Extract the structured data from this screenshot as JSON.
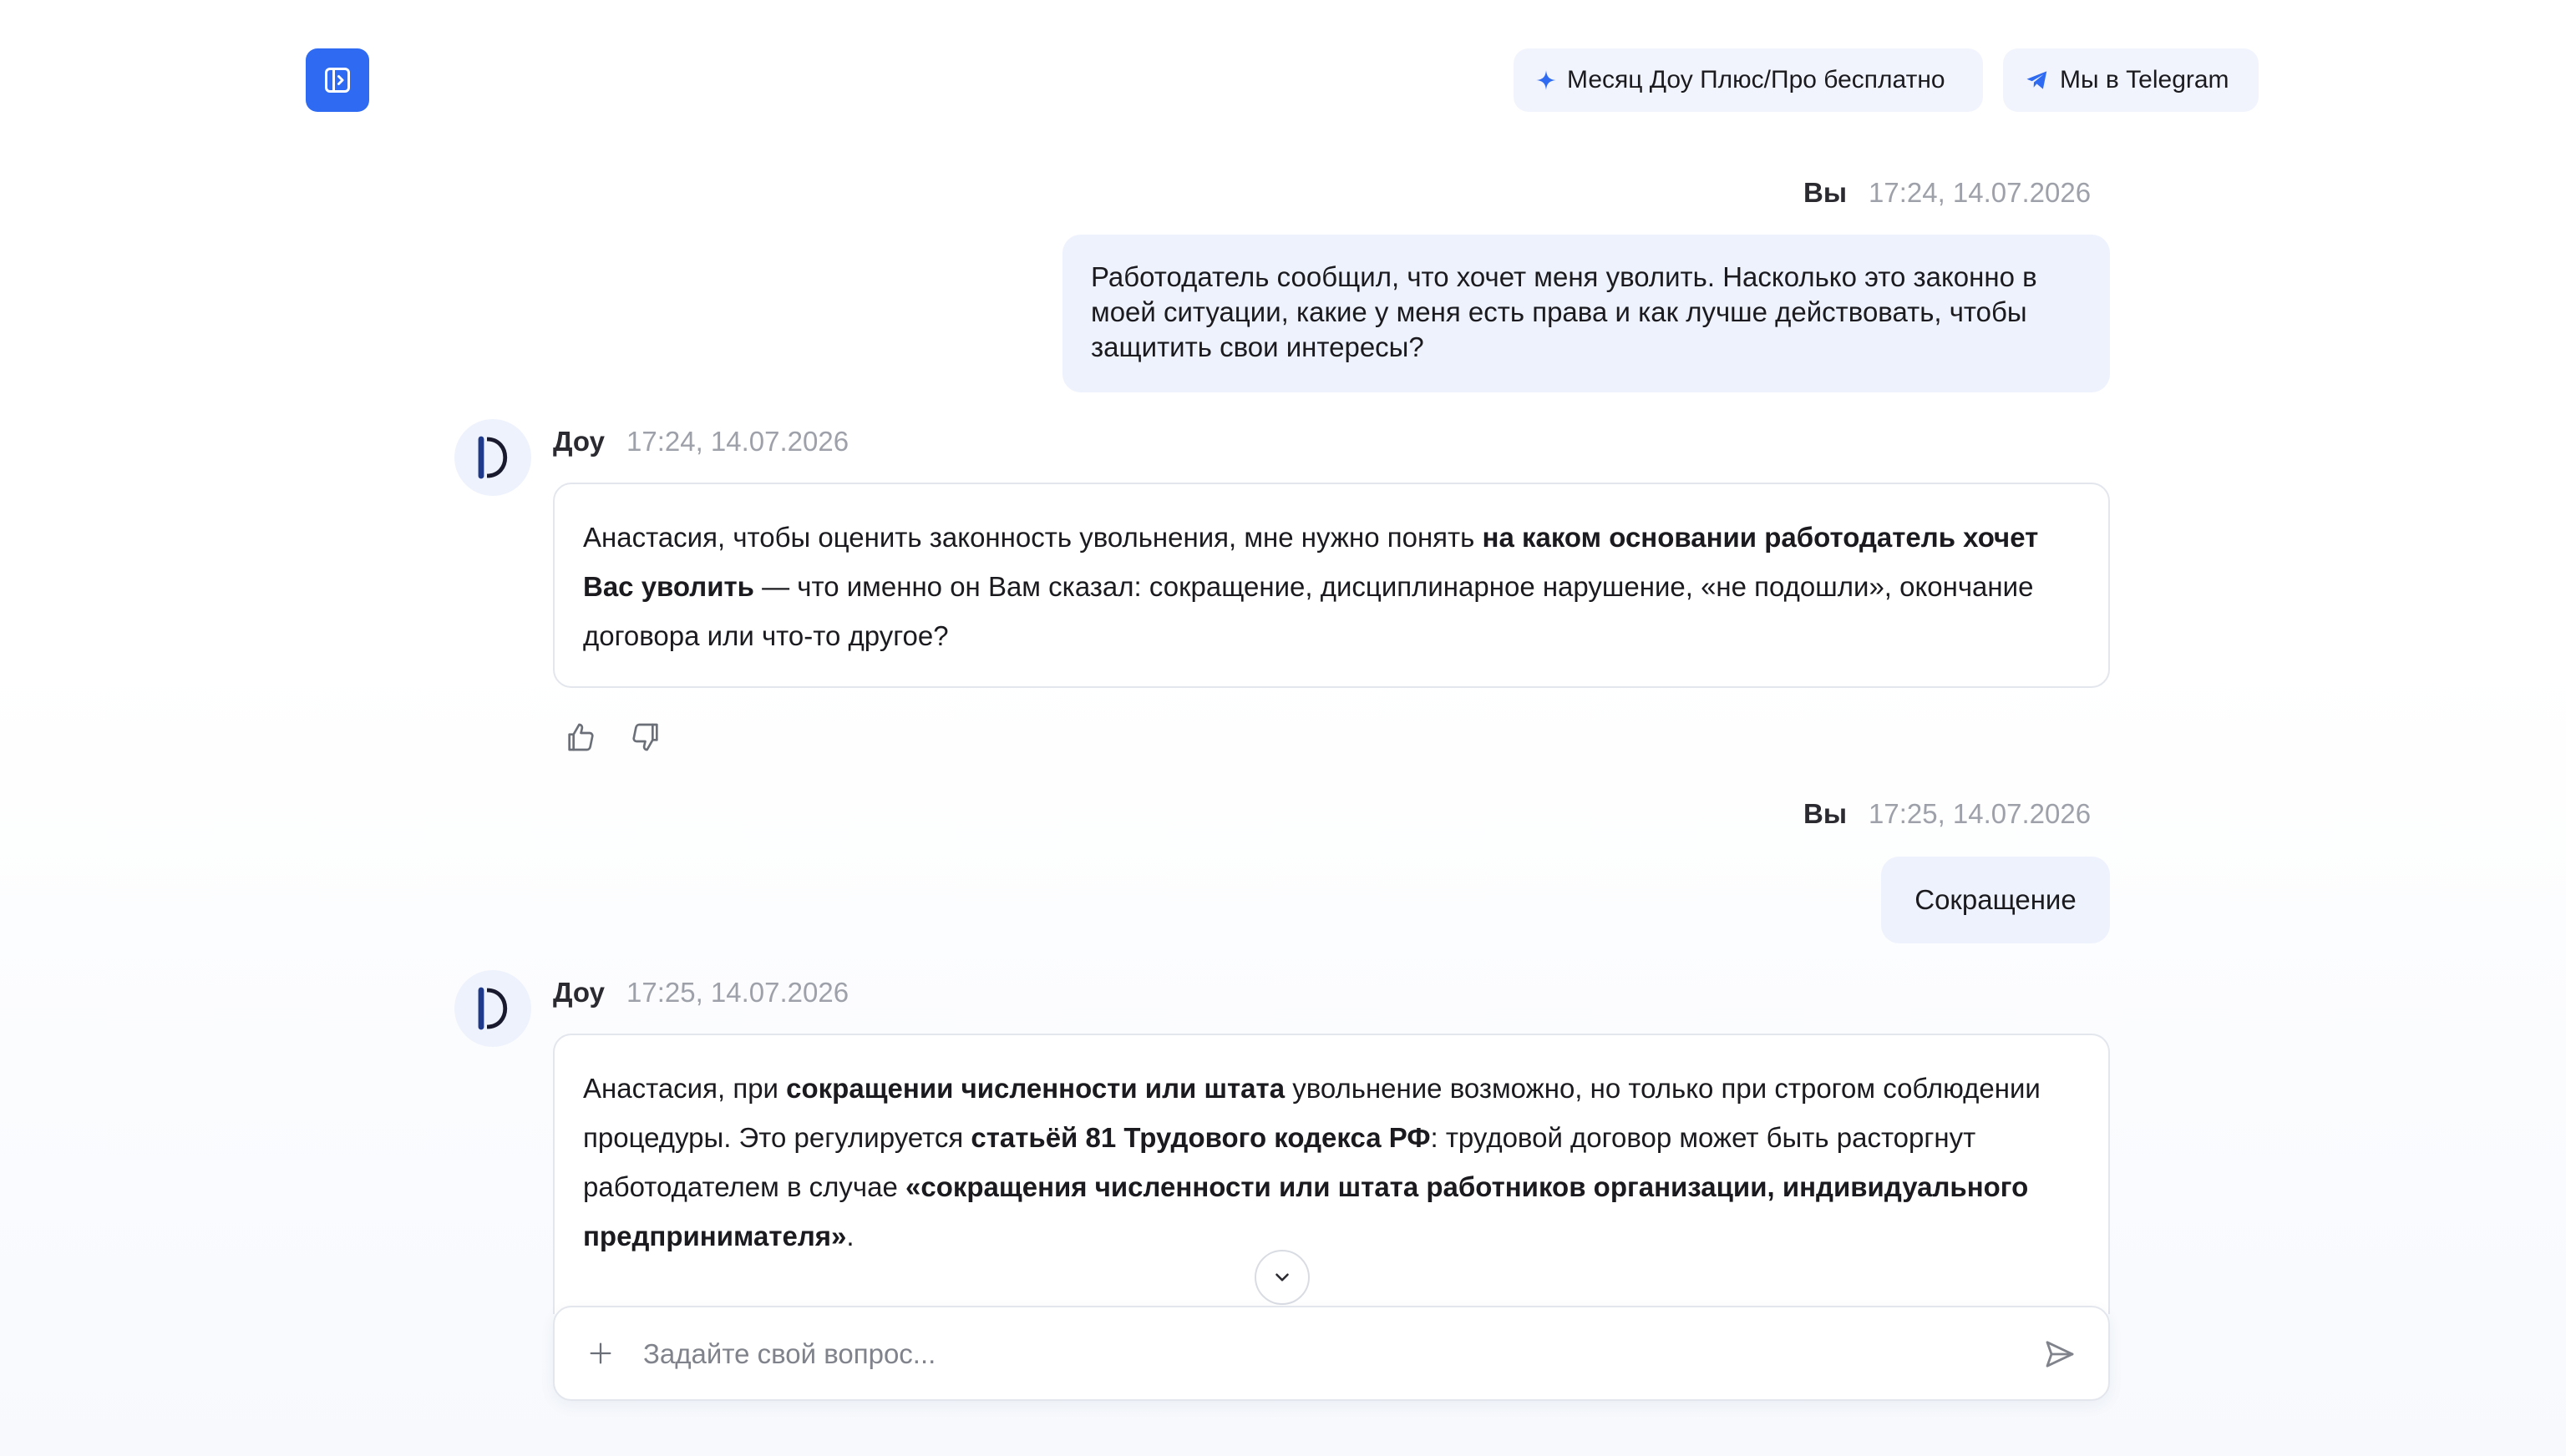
{
  "header": {
    "sidebar_toggle_icon": "sidebar-toggle-icon",
    "promo_label": "Месяц Доу Плюс/Про бесплатно",
    "promo_icon": "sparkle-plus-icon",
    "telegram_label": "Мы в Telegram",
    "telegram_icon": "telegram-icon",
    "accent_color": "#2f6bf2"
  },
  "messages": [
    {
      "author": "Вы",
      "time": "17:24, 14.07.2026",
      "text": "Работодатель сообщил, что хочет меня уволить. Насколько это законно в моей ситуации, какие у меня есть права и как лучше действовать, чтобы защитить свои интересы?"
    },
    {
      "author": "Доу",
      "time": "17:24, 14.07.2026",
      "segments": [
        {
          "text": "Анастасия, чтобы оценить законность увольнения, мне нужно понять ",
          "bold": false
        },
        {
          "text": "на каком основании работодатель хочет Вас уволить",
          "bold": true
        },
        {
          "text": " — что именно он Вам сказал: сокращение, дисциплинарное нарушение, «не подошли», окончание договора или что-то другое?",
          "bold": false
        }
      ]
    },
    {
      "author": "Вы",
      "time": "17:25, 14.07.2026",
      "text": "Сокращение"
    },
    {
      "author": "Доу",
      "time": "17:25, 14.07.2026",
      "segments": [
        {
          "text": "Анастасия, при ",
          "bold": false
        },
        {
          "text": "сокращении численности или штата",
          "bold": true
        },
        {
          "text": " увольнение возможно, но только при строгом соблюдении процедуры. Это регулируется ",
          "bold": false
        },
        {
          "text": "статьёй 81 Трудового кодекса РФ",
          "bold": true
        },
        {
          "text": ": трудовой договор может быть расторгнут работодателем в случае ",
          "bold": false
        },
        {
          "text": "«сокращения численности или штата работников организации, индивидуального предпринимателя»",
          "bold": true
        },
        {
          "text": ".",
          "bold": false
        }
      ]
    }
  ],
  "feedback": {
    "like_icon": "thumbs-up-icon",
    "dislike_icon": "thumbs-down-icon"
  },
  "composer": {
    "placeholder": "Задайте свой вопрос...",
    "value": "",
    "attach_icon": "plus-icon",
    "send_icon": "send-icon"
  },
  "scroll_icon": "chevron-down-icon"
}
